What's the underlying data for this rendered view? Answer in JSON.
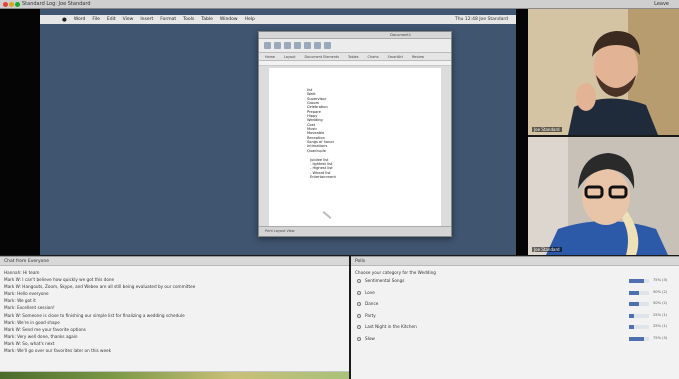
{
  "window": {
    "title": "Standard Log: Joe Standard",
    "right_label": "Leave"
  },
  "menubar": {
    "items": [
      "Word",
      "File",
      "Edit",
      "View",
      "Insert",
      "Format",
      "Tools",
      "Table",
      "Window",
      "Help"
    ],
    "status": "Thu 12:48  Joe Standard"
  },
  "document": {
    "title": "Document1",
    "ribbon": [
      "Home",
      "Layout",
      "Document Elements",
      "Tables",
      "Charts",
      "SmartArt",
      "Review"
    ],
    "lines": [
      "list",
      "Walk",
      "Supervisor",
      "Groom",
      "Celebration",
      "Prepare",
      "Hippy",
      "Wedding",
      "Cost",
      "Music",
      "Moveable",
      "Reception",
      "Songs of honor",
      "Intimations",
      "Quadruple",
      "",
      "Jubilee list",
      "- lightest list",
      "- Highest list",
      "- Wheat list",
      "Entertainment"
    ],
    "status": "Print Layout View"
  },
  "videos": [
    {
      "name": "Joe Standard"
    },
    {
      "name": "Joe Standard"
    }
  ],
  "chat": {
    "title": "Chat from Everyone",
    "messages": [
      "Hannah: Hi team",
      "Mark W: I can't believe how quickly we got this done",
      "Mark W: Hangouts, Zoom, Skype, and Webex are all still being evaluated by our committee",
      "Mark: Hello everyone",
      "Mark: We got it",
      "Mark: Excellent session!",
      "Mark W: Someone is close to finishing our simple list for finalizing a wedding schedule",
      "Mark: We're in good shape",
      "Mark W: Send me your favorite options",
      "Mark: Very well done, thanks again",
      "Mark W: So, what's next",
      "Mark: We'll go over our favorites later on this week"
    ]
  },
  "poll": {
    "title": "Polls",
    "question": "Choose your category for the Wedding",
    "options": [
      {
        "label": "Sentimental Songs",
        "pct": "75% (3)",
        "value": 0.75
      },
      {
        "label": "Love",
        "pct": "50% (2)",
        "value": 0.5
      },
      {
        "label": "Dance",
        "pct": "50% (2)",
        "value": 0.5
      },
      {
        "label": "Party",
        "pct": "25% (1)",
        "value": 0.25
      },
      {
        "label": "Last Night in the Kitchen",
        "pct": "25% (1)",
        "value": 0.25
      },
      {
        "label": "Slow",
        "pct": "75% (3)",
        "value": 0.75
      }
    ]
  },
  "colors": {
    "share_bg": "#3f5570",
    "poll_bar": "#4e6fb0"
  }
}
